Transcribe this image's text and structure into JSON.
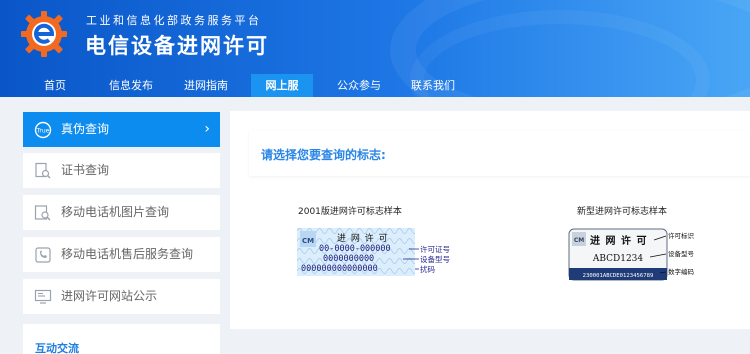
{
  "header": {
    "subtitle": "工业和信息化部政务服务平台",
    "title": "电信设备进网许可"
  },
  "nav": {
    "items": [
      "首页",
      "信息发布",
      "进网指南",
      "网上服务",
      "公众参与",
      "联系我们"
    ],
    "active": "网上服务"
  },
  "sidebar": {
    "items": [
      {
        "label": "真伪查询",
        "icon": "true-badge-icon",
        "active": true
      },
      {
        "label": "证书查询",
        "icon": "document-search-icon"
      },
      {
        "label": "移动电话机图片查询",
        "icon": "image-search-icon"
      },
      {
        "label": "移动电话机售后服务查询",
        "icon": "phone-service-icon"
      },
      {
        "label": "进网许可网站公示",
        "icon": "monitor-list-icon"
      }
    ],
    "section_label": "互动交流",
    "active_color": "#0d8cf0"
  },
  "main": {
    "prompt": "请选择您要查询的标志:",
    "samples": [
      {
        "title": "2001版进网许可标志样本",
        "label_header": "进 网 许 可",
        "lines": [
          "00-0000-000000",
          "0000000000",
          "000000000000000"
        ],
        "annotations": [
          "许可证号",
          "设备型号",
          "扰码"
        ]
      },
      {
        "title": "新型进网许可标志样本",
        "label_header": "进 网 许 可",
        "model": "ABCD1234",
        "code": "230001ABCDE0123456789",
        "annotations": [
          "许可标识",
          "设备型号",
          "数字编码"
        ]
      }
    ]
  },
  "colors": {
    "header_start": "#0a56c8",
    "header_end": "#49a6f5",
    "accent": "#0d8cf0",
    "prompt_text": "#2a86e6"
  }
}
